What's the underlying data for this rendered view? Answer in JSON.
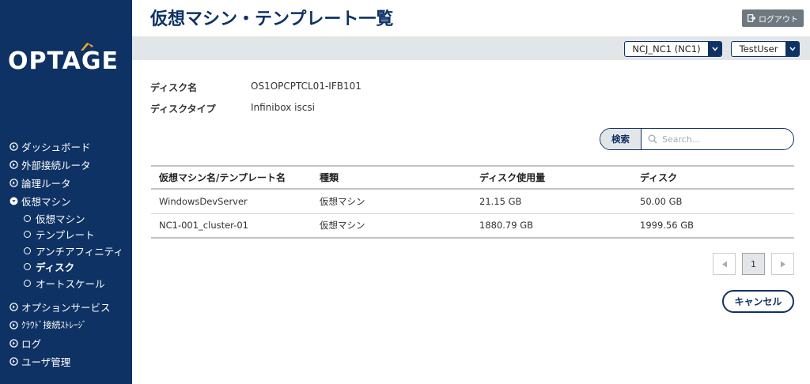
{
  "brand": {
    "logo_text": "OPTAGE"
  },
  "sidebar": {
    "items": [
      {
        "label": "ダッシュボード"
      },
      {
        "label": "外部接続ルータ"
      },
      {
        "label": "論理ルータ"
      },
      {
        "label": "仮想マシン",
        "expanded": true,
        "children": [
          {
            "label": "仮想マシン"
          },
          {
            "label": "テンプレート"
          },
          {
            "label": "アンチアフィニティ"
          },
          {
            "label": "ディスク",
            "active": true
          },
          {
            "label": "オートスケール"
          }
        ]
      },
      {
        "label": "オプションサービス"
      },
      {
        "label": "ｸﾗｳﾄﾞ接続ｽﾄﾚｰｼﾞ"
      },
      {
        "label": "ログ"
      },
      {
        "label": "ユーザ管理"
      }
    ]
  },
  "header": {
    "title": "仮想マシン・テンプレート一覧",
    "logout_label": "ログアウト"
  },
  "toolbar": {
    "tenant_value": "NCJ_NC1 (NC1)",
    "user_value": "TestUser"
  },
  "disk_info": {
    "name_label": "ディスク名",
    "name_value": "OS1OPCPTCL01-IFB101",
    "type_label": "ディスクタイプ",
    "type_value": "Infinibox iscsi"
  },
  "search": {
    "label": "検索",
    "placeholder": "Search..."
  },
  "table": {
    "headers": [
      "仮想マシン名/テンプレート名",
      "種類",
      "ディスク使用量",
      "ディスク"
    ],
    "rows": [
      [
        "WindowsDevServer",
        "仮想マシン",
        "21.15 GB",
        "50.00 GB"
      ],
      [
        "NC1-001_cluster-01",
        "仮想マシン",
        "1880.79 GB",
        "1999.56 GB"
      ]
    ]
  },
  "pagination": {
    "current_page": "1"
  },
  "actions": {
    "cancel_label": "キャンセル"
  },
  "colors": {
    "navy": "#0f3264",
    "subbar": "#e3e6e8",
    "logout": "#6e7880"
  }
}
